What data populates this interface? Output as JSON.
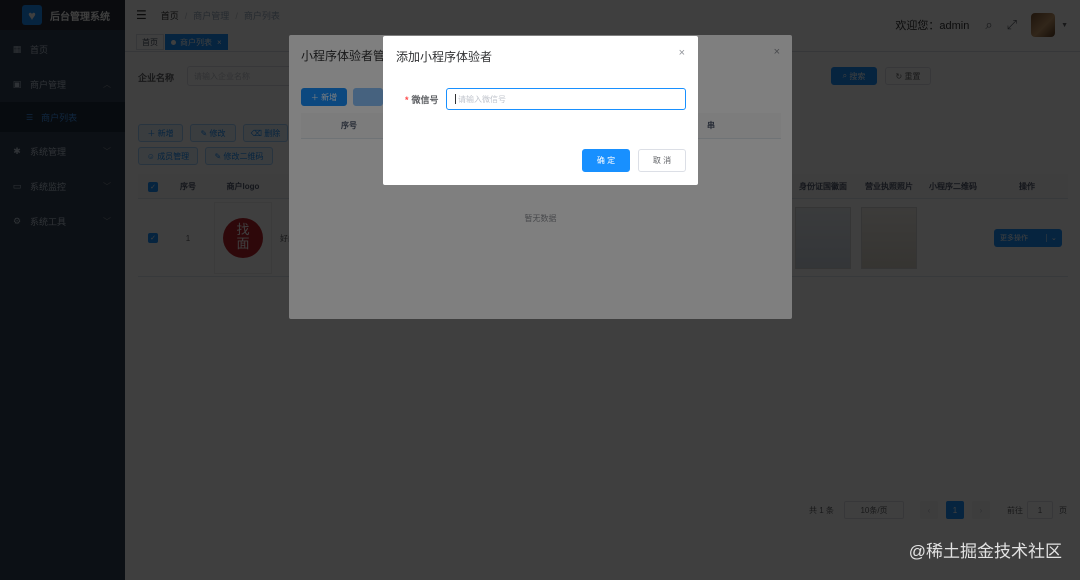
{
  "app": {
    "title": "后台管理系统",
    "logo_icon": "heart-icon"
  },
  "sidebar": {
    "items": [
      {
        "label": "首页",
        "icon": "dashboard-icon"
      },
      {
        "label": "商户管理",
        "icon": "bus-icon"
      },
      {
        "label": "商户列表",
        "icon": "list-icon",
        "active": true
      },
      {
        "label": "系统管理",
        "icon": "gear-icon"
      },
      {
        "label": "系统监控",
        "icon": "monitor-icon"
      },
      {
        "label": "系统工具",
        "icon": "tool-icon"
      }
    ]
  },
  "header": {
    "breadcrumb": [
      "首页",
      "商户管理",
      "商户列表"
    ],
    "welcome": "欢迎您：admin",
    "tags": [
      "首页",
      "商户列表"
    ]
  },
  "filter": {
    "label": "企业名称",
    "placeholder": "请输入企业名称",
    "search": "搜索",
    "reset": "重置"
  },
  "toolbar": {
    "row1": [
      "新增",
      "修改",
      "删除"
    ],
    "row2": [
      "成员管理",
      "修改二维码"
    ]
  },
  "table": {
    "columns": [
      "序号",
      "商户logo",
      "身份证国徽面",
      "营业执照照片",
      "小程序二维码",
      "操作"
    ],
    "rows": [
      {
        "index": "1",
        "name_fragment": "好门",
        "seal_text": "找\n面",
        "action": "更多操作"
      }
    ]
  },
  "pagination": {
    "total": "共 1 条",
    "page_size": "10条/页",
    "current": "1",
    "goto_label": "前往",
    "goto_value": "1",
    "page_suffix": "页"
  },
  "dialog_back": {
    "title": "小程序体验者管理",
    "add": "新增",
    "col_index": "序号",
    "col_right_fragment": "串",
    "empty": "暂无数据"
  },
  "dialog_front": {
    "title": "添加小程序体验者",
    "field_label": "微信号",
    "field_placeholder": "请输入微信号",
    "confirm": "确 定",
    "cancel": "取 消"
  },
  "watermark": "@稀土掘金技术社区",
  "colors": {
    "primary": "#1890ff",
    "sidebar": "#304156",
    "danger": "#ff4949"
  }
}
